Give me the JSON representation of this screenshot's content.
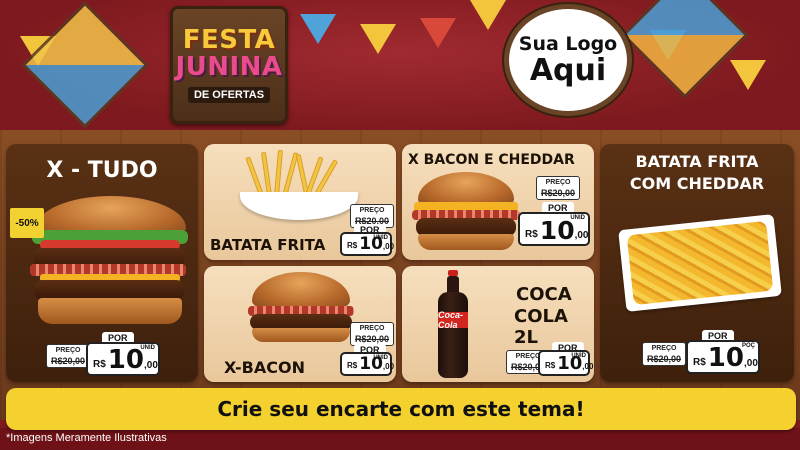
{
  "header": {
    "festa": "FESTA",
    "junina": "JUNINA",
    "subtitle": "DE OFERTAS",
    "logo_line1": "Sua Logo",
    "logo_line2": "Aqui"
  },
  "colors": {
    "background": "#7e1a1f",
    "cta": "#f4d12e",
    "festa_text": "#f7c93b",
    "junina_text": "#e94b8c"
  },
  "products": {
    "xtudo": {
      "name": "X - TUDO",
      "discount": "-50%",
      "old_label": "PREÇO",
      "old_price": "R$20,00",
      "por": "POR",
      "currency": "R$",
      "price_int": "10",
      "price_cents": ",00",
      "unit": "UNID"
    },
    "batata": {
      "name": "BATATA FRITA",
      "old_label": "PREÇO",
      "old_price": "R$20,00",
      "por": "POR",
      "currency": "R$",
      "price_int": "10",
      "price_cents": ",00",
      "unit": "UNID"
    },
    "xbacon_cheddar": {
      "name": "X BACON E CHEDDAR",
      "old_label": "PREÇO",
      "old_price": "R$20,00",
      "por": "POR",
      "currency": "R$",
      "price_int": "10",
      "price_cents": ",00",
      "unit": "UNID"
    },
    "batata_cheddar": {
      "name_line1": "BATATA FRITA",
      "name_line2": "COM CHEDDAR",
      "old_label": "PREÇO",
      "old_price": "R$20,00",
      "por": "POR",
      "currency": "R$",
      "price_int": "10",
      "price_cents": ",00",
      "unit": "POÇ"
    },
    "xbacon": {
      "name": "X-BACON",
      "old_label": "PREÇO",
      "old_price": "R$20,00",
      "por": "POR",
      "currency": "R$",
      "price_int": "10",
      "price_cents": ",00",
      "unit": "UNID"
    },
    "coca": {
      "name_line1": "COCA",
      "name_line2": "COLA 2L",
      "bottle_label": "Coca-Cola",
      "old_label": "PREÇO",
      "old_price": "R$20,00",
      "por": "POR",
      "currency": "R$",
      "price_int": "10",
      "price_cents": ",00",
      "unit": "UNID"
    }
  },
  "cta": "Crie seu encarte com este tema!",
  "disclaimer": "*Imagens Meramente Ilustrativas"
}
